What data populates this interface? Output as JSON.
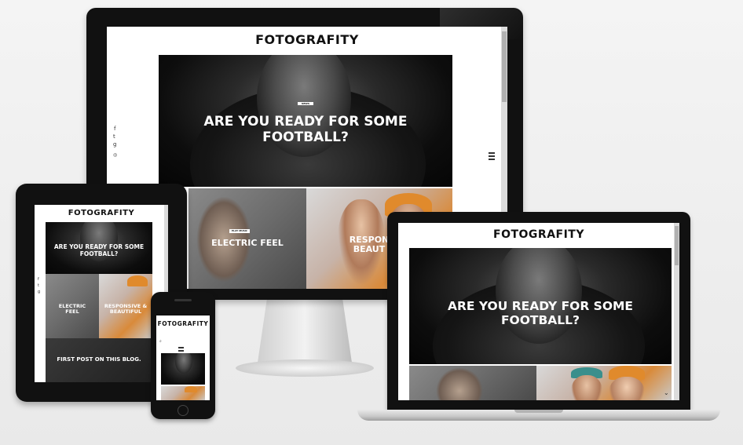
{
  "brand": {
    "logo_text": "FOTOGRAFITY"
  },
  "hero": {
    "category": "NEWS",
    "headline": "ARE YOU READY FOR SOME FOOTBALL?"
  },
  "tiles": {
    "electric_tag": "PLAY MUSIC",
    "electric_title": "ELECTRIC FEEL",
    "responsive_title": "RESPONSIVE & BEAUTIFUL",
    "responsive_title_cut": "RESPON BEAUT",
    "first_post_title": "FIRST POST ON THIS BLOG."
  },
  "social_icons": [
    "facebook-icon",
    "twitter-icon",
    "google-plus-icon",
    "instagram-icon"
  ],
  "devices": [
    "desktop-monitor",
    "tablet",
    "laptop",
    "phone"
  ],
  "colors": {
    "bezel": "#111111",
    "accent_orange": "#d98a3a",
    "screen_bg": "#ffffff"
  }
}
